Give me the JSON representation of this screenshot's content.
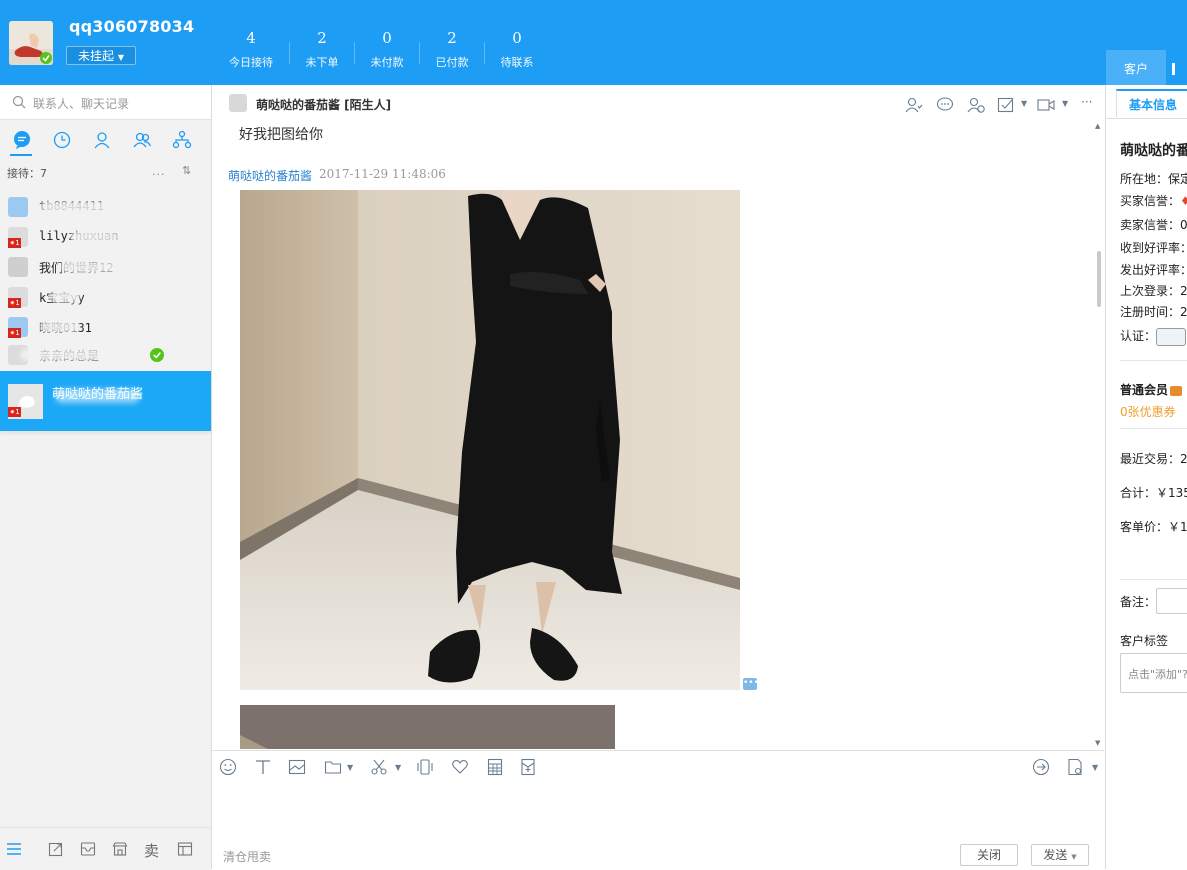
{
  "header": {
    "username": "qq306078034",
    "status_label": "未挂起",
    "stats": [
      {
        "value": "4",
        "label": "今日接待"
      },
      {
        "value": "2",
        "label": "未下单"
      },
      {
        "value": "0",
        "label": "未付款"
      },
      {
        "value": "2",
        "label": "已付款"
      },
      {
        "value": "0",
        "label": "待联系"
      }
    ],
    "right_tab": "客户"
  },
  "sidebar": {
    "search_placeholder": "联系人、聊天记录",
    "reception_label": "接待：7",
    "reception_more": "...",
    "contacts": [
      {
        "name": "tb8844411"
      },
      {
        "name": "lilyzhuxuan"
      },
      {
        "name": "我们的世界12"
      },
      {
        "name": "k宝宝yy"
      },
      {
        "name": "晓晓0131"
      },
      {
        "name": "亲亲的总是"
      }
    ],
    "active_contact": "萌哒哒的番茄酱",
    "bottom_sell_label": "卖"
  },
  "chat": {
    "title": "萌哒哒的番茄酱 [陌生人]",
    "previous_message": "好我把图给你",
    "sender": "萌哒哒的番茄酱",
    "timestamp": "2017-11-29 11:48:06",
    "quick_reply_hint": "清仓甩卖",
    "close_label": "关闭",
    "send_label": "发送"
  },
  "customer_panel": {
    "tab_label": "基本信息",
    "name": "萌哒哒的番茄酱",
    "location_label": "所在地：保定",
    "buyer_credit_label": "买家信誉：",
    "seller_credit_label": "卖家信誉：0",
    "received_rating_label": "收到好评率：",
    "given_rating_label": "发出好评率：",
    "last_login_label": "上次登录：2",
    "register_label": "注册时间：2",
    "verify_label": "认证：",
    "member_level": "普通会员",
    "coupon": "0张优惠券",
    "recent_trade_label": "最近交易：2",
    "total_label": "合计：￥135",
    "avg_price_label": "客单价：￥1",
    "note_label": "备注：",
    "tags_label": "客户标签",
    "tags_placeholder": "点击\"添加\"?"
  },
  "colors": {
    "brand_blue": "#1e9df4",
    "active_contact": "#1ba8f6",
    "link_blue": "#2a82d0",
    "coupon_orange": "#f0a030",
    "badge_red": "#d9261c",
    "online_green": "#52c41a"
  }
}
